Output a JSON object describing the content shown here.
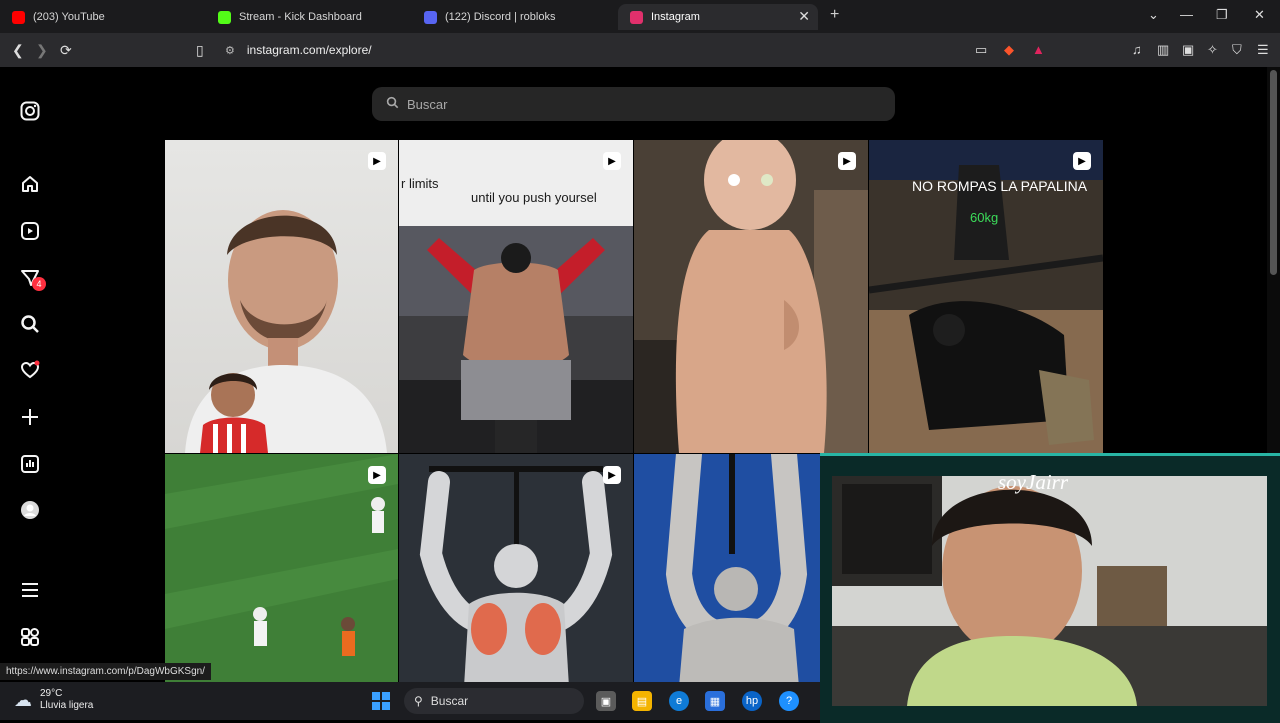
{
  "browser": {
    "tabs": [
      {
        "label": "(203) YouTube",
        "color": "#ff0000"
      },
      {
        "label": "Stream - Kick Dashboard",
        "color": "#53fc18"
      },
      {
        "label": "(122) Discord | robloks",
        "color": "#5865f2"
      },
      {
        "label": "Instagram",
        "color": "#e1306c"
      }
    ],
    "url": "instagram.com/explore/"
  },
  "instagram": {
    "search_placeholder": "Buscar",
    "notifications_badge": "4"
  },
  "tiles": {
    "t2_caption_a": "r limits",
    "t2_caption_b": "until you push yoursel",
    "t4_caption_a": "NO ROMPAS LA PAPALINA",
    "t4_caption_b": "60kg"
  },
  "webcam": {
    "overlay_name": "soyJairr"
  },
  "status_url": "https://www.instagram.com/p/DagWbGKSgn/",
  "taskbar": {
    "temperature": "29°C",
    "condition": "Lluvia ligera",
    "search_label": "Buscar"
  }
}
